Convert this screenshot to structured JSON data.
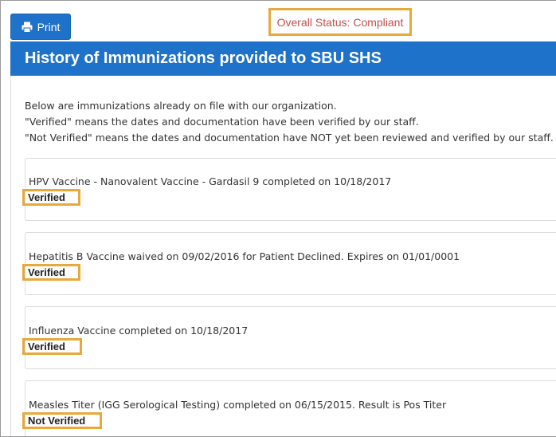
{
  "toolbar": {
    "print_label": "Print",
    "print_icon": "printer-icon"
  },
  "status": {
    "text": "Overall Status: Compliant",
    "color": "#c0504d"
  },
  "panel": {
    "title": "History of Immunizations provided to SBU SHS",
    "intro": [
      "Below are immunizations already on file with our organization.",
      "\"Verified\" means the dates and documentation have been verified by our staff.",
      "\"Not Verified\" means the dates and documentation have NOT yet been reviewed and verified by our staff."
    ]
  },
  "immunizations": [
    {
      "description": "HPV Vaccine - Nanovalent Vaccine - Gardasil 9 completed on 10/18/2017",
      "status": "Verified"
    },
    {
      "description": "Hepatitis B Vaccine waived on 09/02/2016 for Patient Declined. Expires on 01/01/0001",
      "status": "Verified"
    },
    {
      "description": "Influenza Vaccine completed on 10/18/2017",
      "status": "Verified"
    },
    {
      "description": "Measles Titer (IGG Serological Testing) completed on 06/15/2015. Result is Pos Titer",
      "status": "Not Verified"
    }
  ],
  "colors": {
    "brand_blue": "#1f72c9",
    "highlight_orange": "#e8a93b"
  }
}
